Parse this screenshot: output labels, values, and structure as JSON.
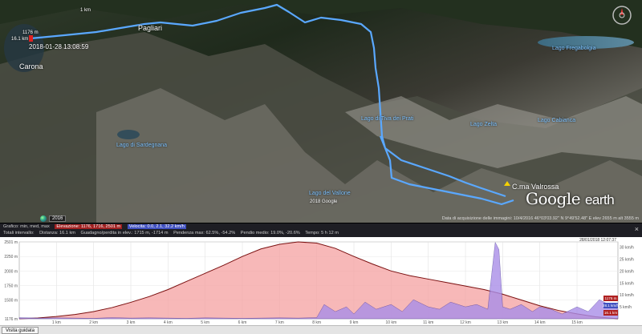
{
  "map": {
    "labels": {
      "pagliari": "Pagliari",
      "carona": "Carona",
      "lago_fregabolgia": "Lago Fregabolgia",
      "lago_sardegnana": "Lago di Sardegnana",
      "lago_vallone": "Lago del Vallone",
      "lago_zelta": "Lago Zelta",
      "lago_cabianca": "Lago Cabianca",
      "lago_tiva": "Lago di Tiva dei Prati",
      "cima": "C.ma Valrossa",
      "timestamp": "2018-01-28 13:08:59",
      "elev_left_1": "1176 m",
      "elev_left_2": "16.1 km",
      "copyright": "2018 Google",
      "ruler_top": "1 km"
    },
    "logo": {
      "word1": "Google",
      "word2": "earth"
    },
    "year": "2016",
    "status": "Data di acquisizione delle immagini: 10/4/2016   46°03'03.92\" N   9°49'52.48\" E   elev 2655 m   alt 3555 m",
    "colors": {
      "track": "#5aa8ff",
      "label": "#7fc3ff"
    }
  },
  "toolbar": {
    "row1_label": "Grafico: min, med, max",
    "elev_label": "Elevazione: 1176, 1716, 2501 m",
    "speed_label": "Velocita: 0.0, 2.1, 32.2 km/h",
    "row2_total": "Totali intervallo:",
    "distance": "Distanza: 16.1 km",
    "gain": "Guadagno/perdita in elev.: 1715 m, -1714 m",
    "slope_max": "Pendenza max: 62.5%, -54.2%",
    "slope_avg": "Pendio medio: 19.0%, -20.6%",
    "time": "Tempo: 5 h 12 m",
    "close": "×"
  },
  "bottom": {
    "guided_tour": "Visita guidata"
  },
  "chart_data": {
    "type": "area",
    "title": "",
    "x_unit": "km",
    "x_ticks": [
      "1 km",
      "2 km",
      "3 km",
      "4 km",
      "5 km",
      "6 km",
      "7 km",
      "8 km",
      "9 km",
      "10 km",
      "11 km",
      "12 km",
      "13 km",
      "14 km",
      "15 km"
    ],
    "y_left_ticks": [
      "2501 m",
      "2250 m",
      "2000 m",
      "1750 m",
      "1500 m",
      "1176 m"
    ],
    "y_right_ticks": [
      "30 km/h",
      "25 km/h",
      "20 km/h",
      "15 km/h",
      "10 km/h",
      "5 km/h"
    ],
    "xlim": [
      0,
      16.1
    ],
    "ylim_elev": [
      1176,
      2501
    ],
    "ylim_speed": [
      0,
      32.2
    ],
    "timestamp_top": "28/01/2018 12:07:37",
    "right_edge_elev": "1176 m",
    "right_edge_speed": "28.1 km/h",
    "right_edge_dist": "16.1 km",
    "series": [
      {
        "name": "Elevazione",
        "color": "#f4a0a0",
        "x": [
          0,
          0.5,
          1,
          1.5,
          2,
          2.5,
          3,
          3.5,
          4,
          4.5,
          5,
          5.5,
          6,
          6.5,
          7,
          7.5,
          8,
          8.5,
          9,
          9.5,
          10,
          10.5,
          11,
          11.5,
          12,
          12.5,
          13,
          13.5,
          14,
          14.5,
          15,
          15.5,
          16.1
        ],
        "y": [
          1176,
          1190,
          1215,
          1250,
          1300,
          1370,
          1460,
          1560,
          1680,
          1820,
          1960,
          2100,
          2250,
          2380,
          2460,
          2501,
          2480,
          2390,
          2250,
          2120,
          2000,
          1920,
          1860,
          1800,
          1740,
          1680,
          1600,
          1500,
          1400,
          1320,
          1260,
          1210,
          1176
        ]
      },
      {
        "name": "Velocita",
        "color": "#a98ee8",
        "x": [
          0,
          0.5,
          1,
          1.5,
          2,
          2.5,
          3,
          3.5,
          4,
          4.5,
          5,
          5.5,
          6,
          6.5,
          7,
          7.5,
          8,
          8.2,
          8.5,
          8.8,
          9,
          9.3,
          9.6,
          10,
          10.3,
          10.6,
          11,
          11.3,
          11.6,
          12,
          12.3,
          12.6,
          12.8,
          12.9,
          13,
          13.2,
          13.5,
          13.8,
          14,
          14.3,
          14.6,
          15,
          15.3,
          15.6,
          16.1
        ],
        "y": [
          0.5,
          0.3,
          0.4,
          0.3,
          0.2,
          0.5,
          0.3,
          0.4,
          0.3,
          0.2,
          0.4,
          0.3,
          0.2,
          0.3,
          0.4,
          0.3,
          0.5,
          6,
          3,
          5,
          2,
          7,
          4,
          6,
          3,
          8,
          5,
          4,
          7,
          5,
          6,
          4,
          32,
          29,
          5,
          4,
          6,
          3,
          5,
          4,
          2,
          5,
          3,
          8,
          4
        ]
      }
    ]
  }
}
